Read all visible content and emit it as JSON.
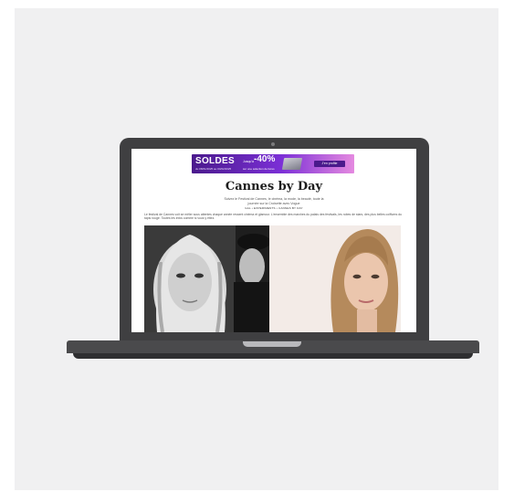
{
  "ad": {
    "headline": "SOLDES",
    "subline": "du 08/01/2025 au 04/02/2025",
    "upto": "Jusqu'à",
    "discount": "-40%",
    "selection": "sur une sélection de livres",
    "cta": "J'en profite",
    "colors": {
      "start": "#4a1a8c",
      "mid": "#7b2fd6",
      "end": "#e58ae0"
    }
  },
  "article": {
    "title": "Cannes by Day",
    "intro": "Suivez le Festival de Cannes, le cinéma, la mode, la beauté, toute la journée sur la Croisette avec Vogue",
    "byline": "GAL  •  EXPERIMENTS  •  CANNES BY DAY",
    "body": "Le festival de Cannes voit se mêler sous attentes chaque année ressent cinéma et glamour. L'ensemble des marches du palais des festivals, les robes de stars, des plus belles coiffures du tapis rouge. Toutes les infos comme si vous y étiez."
  },
  "device": {
    "frame_color": "#3f3f41",
    "background": "#f0f0f1"
  }
}
